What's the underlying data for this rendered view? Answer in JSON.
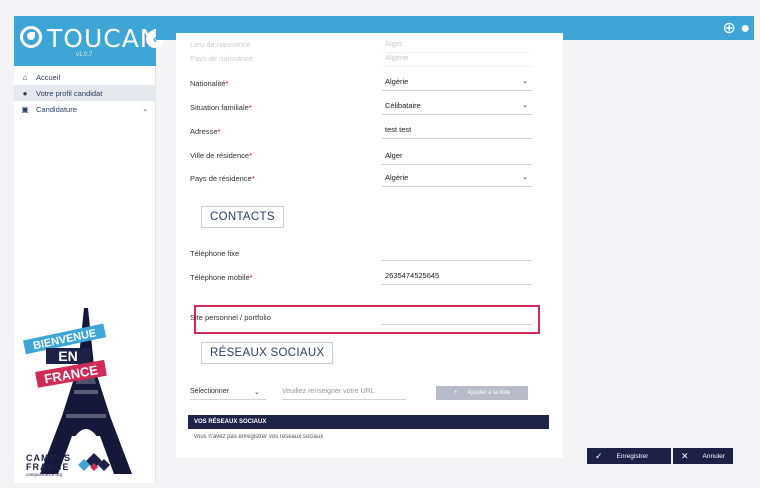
{
  "app": {
    "name": "TOUCAN",
    "version": "v1.0.7"
  },
  "sidebar": {
    "items": [
      {
        "label": "Accueil",
        "icon": "home-icon"
      },
      {
        "label": "Votre profil candidat",
        "icon": "user-icon"
      },
      {
        "label": "Candidature",
        "icon": "folder-icon"
      }
    ]
  },
  "welcome": {
    "bienvenue": "BIENVENUE",
    "en": "EN",
    "france": "FRANCE",
    "campus_line1": "CAMPUS",
    "campus_line2": "FRANCE",
    "campus_url": "campusfrance.org"
  },
  "form": {
    "faded_rows": [
      {
        "label": "Lieu de naissance",
        "value": "Alger"
      },
      {
        "label": "Pays de naissance",
        "value": "Algérie"
      }
    ],
    "rows": [
      {
        "label": "Nationalité",
        "required": "*",
        "value": "Algérie",
        "dropdown": true
      },
      {
        "label": "Situation familiale",
        "required": "*",
        "value": "Célibataire",
        "dropdown": true
      },
      {
        "label": "Adresse",
        "required": "*",
        "value": "test test",
        "dropdown": false
      },
      {
        "label": "Ville de résidence",
        "required": "*",
        "value": "Alger",
        "dropdown": false
      },
      {
        "label": "Pays de résidence",
        "required": "*",
        "value": "Algérie",
        "dropdown": true
      }
    ],
    "contacts_title": "CONTACTS",
    "phone_fixed_label": "Téléphone fixe",
    "phone_fixed_value": "",
    "phone_mobile_label": "Téléphone mobile",
    "phone_mobile_required": "*",
    "phone_mobile_value": "2635474525645",
    "website_label": "Site personnel / portfolio",
    "website_value": "",
    "social_title": "RÉSEAUX SOCIAUX",
    "social_select": "Sélectionner",
    "social_url_placeholder": "Veuillez renseigner votre URL",
    "social_add": "Ajouter à la liste",
    "networks_header": "VOS RÉSEAUX SOCIAUX",
    "networks_empty": "vous n'avez pas enregistrer vos reseaux sociaux"
  },
  "actions": {
    "save": "Enregistrer",
    "cancel": "Annuler"
  },
  "colors": {
    "brand": "#3ea6d6",
    "navy": "#1e2147",
    "highlight": "#d12a55"
  }
}
